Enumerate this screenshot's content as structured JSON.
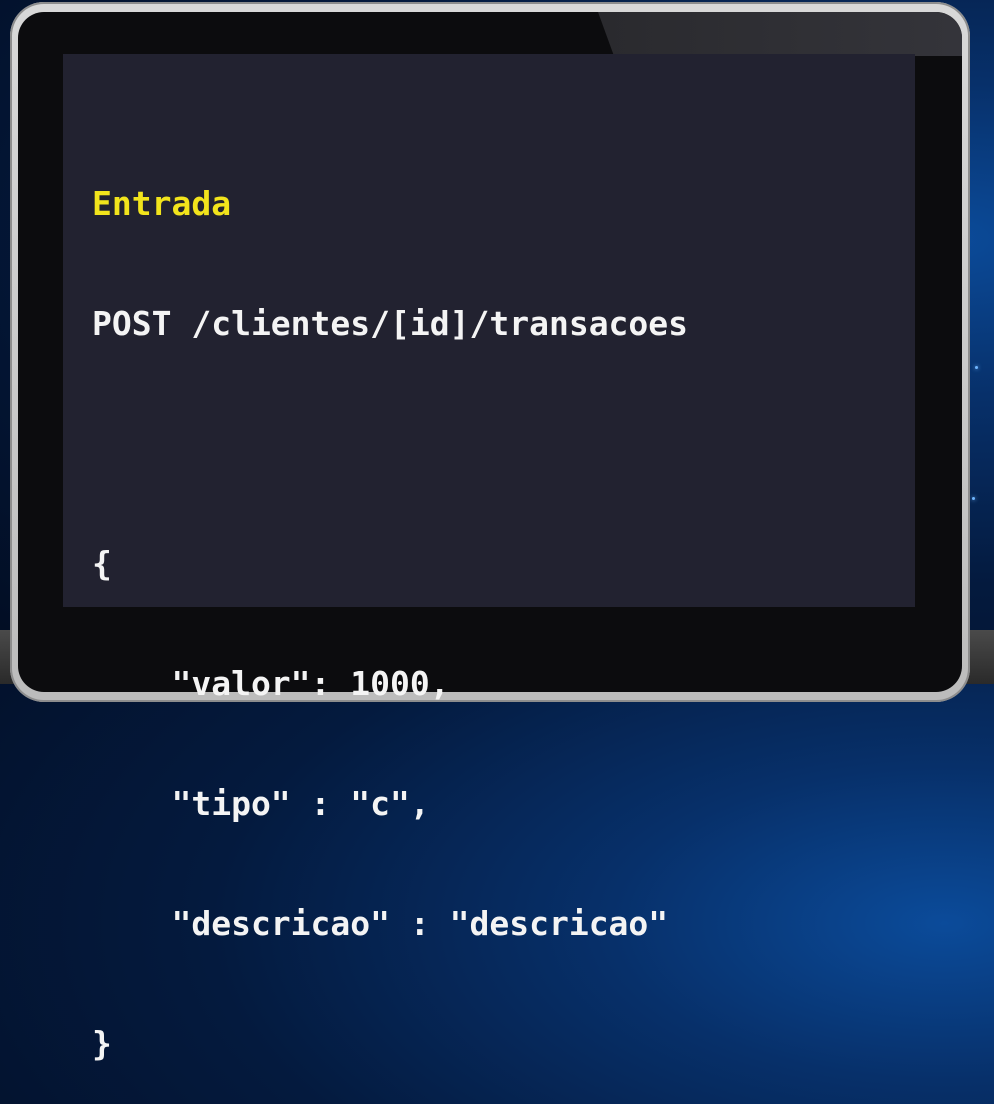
{
  "code": {
    "heading": "Entrada",
    "request_line": "POST /clientes/[id]/transacoes",
    "body_lines": [
      "{",
      "    \"valor\": 1000,",
      "    \"tipo\" : \"c\",",
      "    \"descricao\" : \"descricao\"",
      "}"
    ]
  },
  "colors": {
    "heading": "#f2e41c",
    "code_text": "#f4f4f4",
    "screen_background": "#222230"
  }
}
